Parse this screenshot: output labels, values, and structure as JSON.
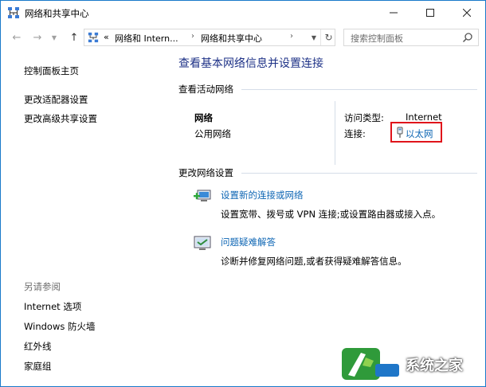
{
  "window": {
    "title": "网络和共享中心",
    "controls": {
      "minimize": "minimize-icon",
      "maximize": "maximize-icon",
      "close": "close-icon"
    }
  },
  "address_bar": {
    "overflow": "«",
    "segments": [
      "网络和 Intern...",
      "网络和共享中心"
    ],
    "search_placeholder": "搜索控制面板"
  },
  "sidebar": {
    "top_items": [
      {
        "label": "控制面板主页"
      },
      {
        "label": "更改适配器设置"
      },
      {
        "label": "更改高级共享设置"
      }
    ],
    "see_also_heading": "另请参阅",
    "see_also_items": [
      {
        "label": "Internet 选项"
      },
      {
        "label": "Windows 防火墙"
      },
      {
        "label": "红外线"
      },
      {
        "label": "家庭组"
      }
    ]
  },
  "main": {
    "title": "查看基本网络信息并设置连接",
    "active_networks": {
      "header": "查看活动网络",
      "network_name": "网络",
      "network_category": "公用网络",
      "access_type_label": "访问类型:",
      "access_type_value": "Internet",
      "connections_label": "连接:",
      "connection_name": "以太网",
      "highlight_color": "#e0141b"
    },
    "change_settings": {
      "header": "更改网络设置",
      "tasks": [
        {
          "link": "设置新的连接或网络",
          "description": "设置宽带、拨号或 VPN 连接;或设置路由器或接入点。",
          "icon": "new-connection-icon"
        },
        {
          "link": "问题疑难解答",
          "description": "诊断并修复网络问题,或者获得疑难解答信息。",
          "icon": "troubleshoot-icon"
        }
      ]
    }
  },
  "watermark": {
    "text": "系统之家"
  },
  "colors": {
    "title_blue": "#1e3287",
    "link_blue": "#0e66b4",
    "border": "#1979ca"
  }
}
